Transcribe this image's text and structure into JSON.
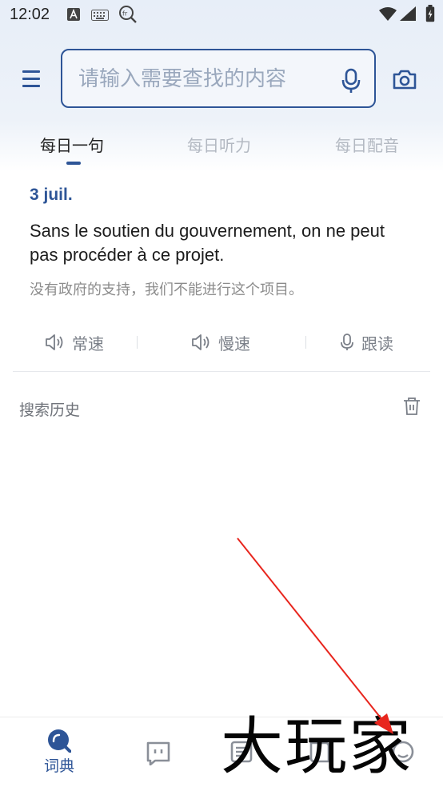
{
  "status_bar": {
    "time": "12:02",
    "icons": [
      "a-icon",
      "keyboard-icon",
      "fr-search-icon",
      "wifi-icon",
      "signal-icon",
      "battery-icon"
    ]
  },
  "header": {
    "search_placeholder": "请输入需要查找的内容",
    "icons": [
      "menu-icon",
      "microphone-icon",
      "camera-icon"
    ]
  },
  "tabs": [
    {
      "label": "每日一句",
      "active": true
    },
    {
      "label": "每日听力",
      "active": false
    },
    {
      "label": "每日配音",
      "active": false
    }
  ],
  "daily": {
    "date": "3 juil.",
    "sentence": "Sans le soutien du gouvernement, on ne peut pas procéder à ce projet.",
    "translation": "没有政府的支持，我们不能进行这个项目。"
  },
  "audio_controls": [
    {
      "label": "常速",
      "icon": "speaker-icon"
    },
    {
      "label": "慢速",
      "icon": "speaker-icon"
    },
    {
      "label": "跟读",
      "icon": "microphone-icon"
    }
  ],
  "history": {
    "title": "搜索历史",
    "icon": "trash-icon"
  },
  "bottom_nav": [
    {
      "label": "词典",
      "icon": "dictionary-search-icon",
      "active": true
    },
    {
      "label": "",
      "icon": "chat-icon",
      "active": false
    },
    {
      "label": "",
      "icon": "notes-icon",
      "active": false
    },
    {
      "label": "",
      "icon": "book-icon",
      "active": false
    },
    {
      "label": "",
      "icon": "profile-icon",
      "active": false
    }
  ],
  "watermark": {
    "text": "大玩家"
  },
  "colors": {
    "accent": "#2e5597",
    "annotation_arrow": "#e8261e",
    "muted_text": "#8c8c8c",
    "inactive_tab": "#b3b9c2"
  }
}
